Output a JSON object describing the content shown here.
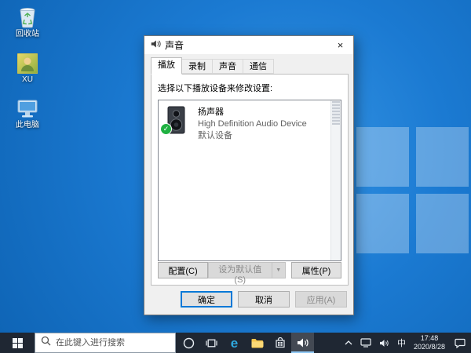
{
  "desktop": {
    "icons": [
      {
        "label": "回收站"
      },
      {
        "label": "XU"
      },
      {
        "label": "此电脑"
      }
    ]
  },
  "dialog": {
    "title": "声音",
    "tabs": [
      {
        "label": "播放"
      },
      {
        "label": "录制"
      },
      {
        "label": "声音"
      },
      {
        "label": "通信"
      }
    ],
    "instruction": "选择以下播放设备来修改设置:",
    "device": {
      "name": "扬声器",
      "driver": "High Definition Audio Device",
      "status": "默认设备"
    },
    "buttons": {
      "configure": "配置(C)",
      "set_default": "设为默认值(S)",
      "properties": "属性(P)",
      "ok": "确定",
      "cancel": "取消",
      "apply": "应用(A)"
    }
  },
  "taskbar": {
    "search_placeholder": "在此键入进行搜索",
    "input_indicator": "中",
    "time": "17:48",
    "date": "2020/8/28"
  },
  "glyphs": {
    "close": "×",
    "dropdown": "▼",
    "check": "✓",
    "edge": "e"
  },
  "colors": {
    "accent": "#0078d7",
    "desktop_blue": "#1b7ad2",
    "taskbar_bg": "#1f2733",
    "check_green": "#1fb141"
  }
}
